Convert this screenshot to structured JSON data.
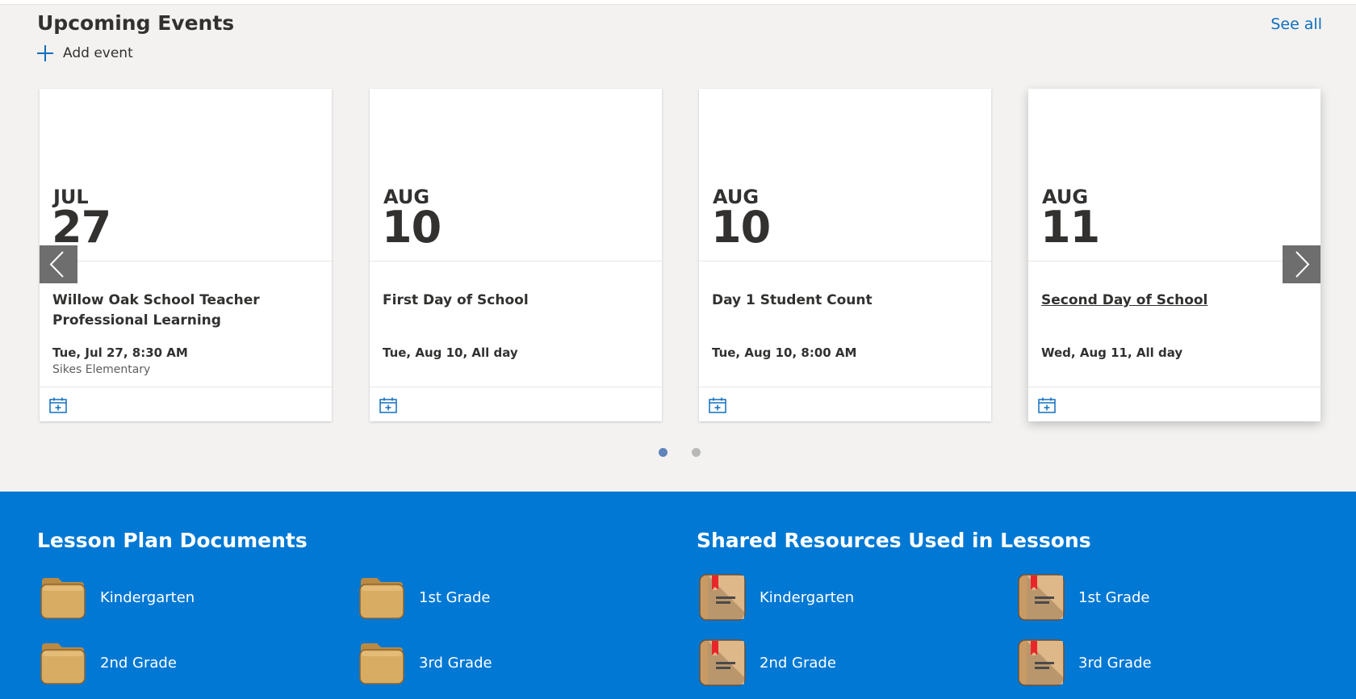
{
  "events": {
    "title": "Upcoming Events",
    "see_all": "See all",
    "add_event": "Add event",
    "cards": [
      {
        "month": "JUL",
        "day": "27",
        "title": "Willow Oak School Teacher Professional Learning",
        "when": "Tue, Jul 27, 8:30 AM",
        "where": "Sikes Elementary"
      },
      {
        "month": "AUG",
        "day": "10",
        "title": "First Day of School",
        "when": "Tue, Aug 10, All day",
        "where": ""
      },
      {
        "month": "AUG",
        "day": "10",
        "title": "Day 1 Student Count",
        "when": "Tue, Aug 10, 8:00 AM",
        "where": ""
      },
      {
        "month": "AUG",
        "day": "11",
        "title": "Second Day of School",
        "when": "Wed, Aug 11, All day",
        "where": ""
      }
    ],
    "pager": {
      "pages": 2,
      "active": 1
    }
  },
  "lesson_docs": {
    "title": "Lesson Plan Documents",
    "items": [
      "Kindergarten",
      "1st Grade",
      "2nd Grade",
      "3rd Grade"
    ]
  },
  "shared_resources": {
    "title": "Shared Resources Used in Lessons",
    "items": [
      "Kindergarten",
      "1st Grade",
      "2nd Grade",
      "3rd Grade"
    ]
  },
  "colors": {
    "accent": "#0078d4",
    "link": "#106ebe",
    "folder": "#d9ac63",
    "book_cover": "#c99a64",
    "bookmark": "#e8262a"
  },
  "icons": [
    "plus-icon",
    "calendar-add-icon",
    "chevron-left-icon",
    "chevron-right-icon",
    "folder-icon",
    "book-icon"
  ]
}
